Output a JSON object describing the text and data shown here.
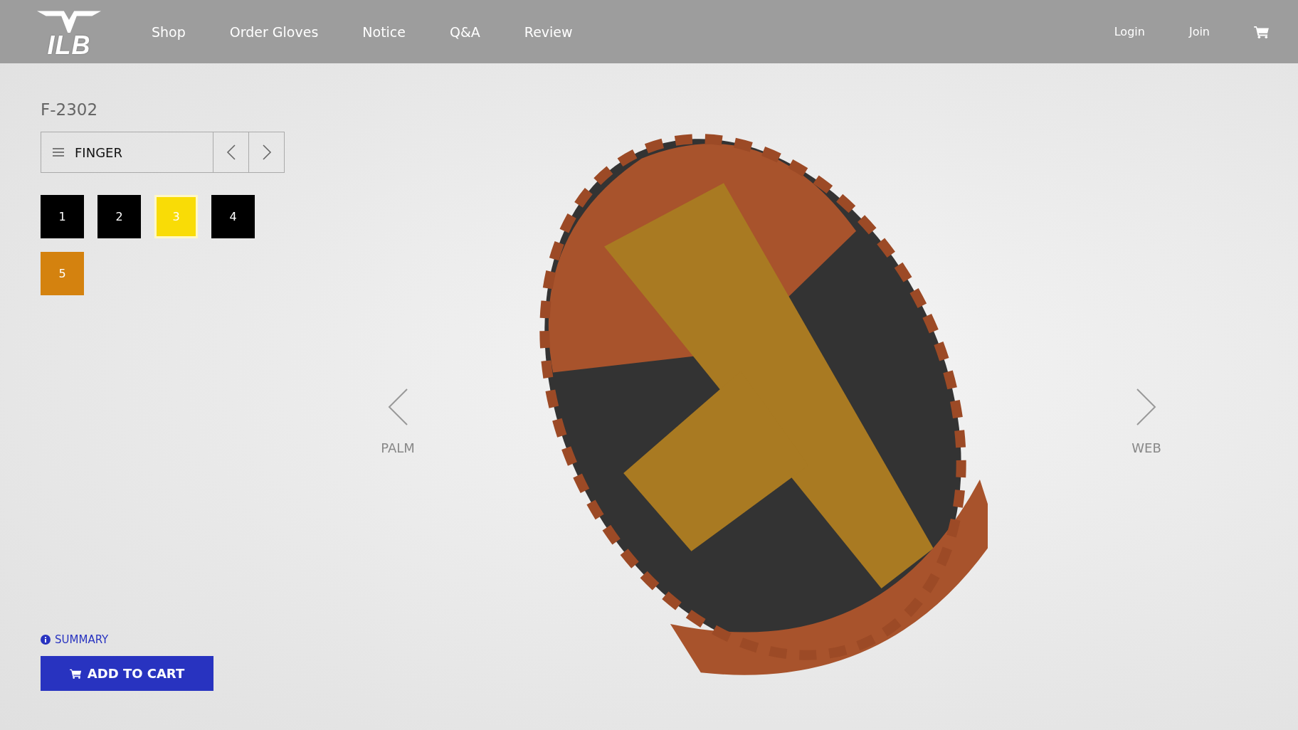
{
  "logo": {
    "text": "ILB"
  },
  "nav": [
    {
      "label": "Shop"
    },
    {
      "label": "Order Gloves"
    },
    {
      "label": "Notice"
    },
    {
      "label": "Q&A"
    },
    {
      "label": "Review"
    }
  ],
  "account": [
    {
      "label": "Login"
    },
    {
      "label": "Join"
    }
  ],
  "product": {
    "code": "F-2302"
  },
  "part_selector": {
    "label": "FINGER"
  },
  "swatches": [
    {
      "label": "1",
      "color": "#000000",
      "selected": false
    },
    {
      "label": "2",
      "color": "#000000",
      "selected": false
    },
    {
      "label": "3",
      "color": "#f9dc06",
      "selected": true
    },
    {
      "label": "4",
      "color": "#000000",
      "selected": false
    },
    {
      "label": "5",
      "color": "#d4820f",
      "selected": false
    }
  ],
  "views": [
    {
      "label": "PALM"
    },
    {
      "label": "WEB"
    }
  ],
  "summary": {
    "label": "SUMMARY"
  },
  "add_to_cart": {
    "label": "ADD TO CART"
  }
}
